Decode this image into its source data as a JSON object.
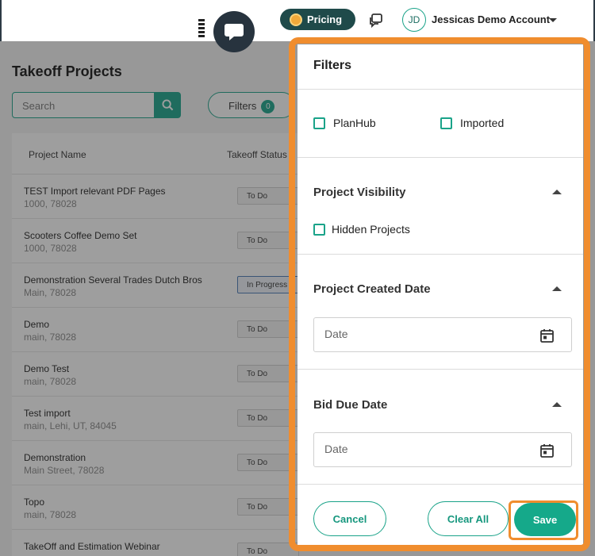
{
  "topbar": {
    "pricing_label": "Pricing",
    "avatar_initials": "JD",
    "account_name": "Jessicas Demo Account"
  },
  "main": {
    "title": "Takeoff Projects",
    "search_placeholder": "Search",
    "filters_label": "Filters",
    "filters_count": "0",
    "columns": [
      "Project Name",
      "Takeoff Status"
    ],
    "rows": [
      {
        "name": "TEST Import relevant PDF Pages",
        "address": "1000, 78028",
        "status": "To Do"
      },
      {
        "name": "Scooters Coffee Demo Set",
        "address": "1000, 78028",
        "status": "To Do"
      },
      {
        "name": "Demonstration Several Trades Dutch Bros",
        "address": "Main, 78028",
        "status": "In Progress"
      },
      {
        "name": "Demo",
        "address": "main, 78028",
        "status": "To Do"
      },
      {
        "name": "Demo Test",
        "address": "main, 78028",
        "status": "To Do"
      },
      {
        "name": "Test import",
        "address": "main, Lehi, UT, 84045",
        "status": "To Do"
      },
      {
        "name": "Demonstration",
        "address": "Main Street, 78028",
        "status": "To Do"
      },
      {
        "name": "Topo",
        "address": "main, 78028",
        "status": "To Do"
      },
      {
        "name": "TakeOff and Estimation Webinar",
        "address": "",
        "status": "To Do"
      }
    ]
  },
  "panel": {
    "title": "Filters",
    "source_options": [
      "PlanHub",
      "Imported"
    ],
    "visibility": {
      "title": "Project Visibility",
      "option": "Hidden Projects"
    },
    "created_date": {
      "title": "Project Created Date",
      "placeholder": "Date"
    },
    "bid_due_date": {
      "title": "Bid Due Date",
      "placeholder": "Date"
    },
    "cancel_label": "Cancel",
    "clear_label": "Clear All",
    "save_label": "Save"
  },
  "colors": {
    "accent": "#19a58a",
    "highlight": "#f08d2e",
    "dark": "#27333e"
  }
}
